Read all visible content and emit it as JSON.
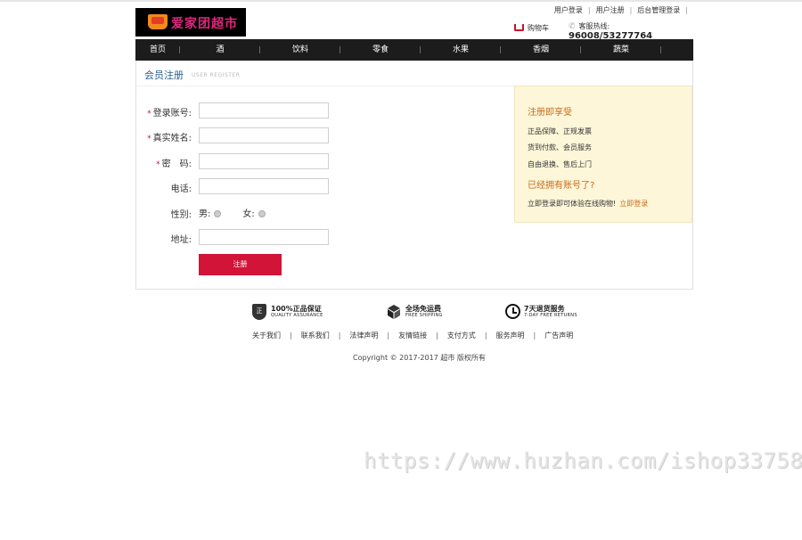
{
  "header": {
    "logo_text": "爱家团超市",
    "top_links": [
      "用户登录",
      "用户注册",
      "后台管理登录"
    ],
    "cart_label": "购物车",
    "hotline_label": "客服热线:",
    "hotline_number": "96008/53277764"
  },
  "nav": [
    "首页",
    "酒",
    "饮料",
    "零食",
    "水果",
    "香烟",
    "蔬菜"
  ],
  "panel": {
    "title": "会员注册",
    "subtitle": "USER REGISTER"
  },
  "form": {
    "account_label": "登录账号:",
    "realname_label": "真实姓名:",
    "password_label": "密　码:",
    "phone_label": "电话:",
    "gender_label": "性别:",
    "male_label": "男:",
    "female_label": "女:",
    "address_label": "地址:",
    "required_mark": "*",
    "submit_label": "注册"
  },
  "side": {
    "heading": "注册即享受",
    "benefits": [
      "正品保障、正规发票",
      "货到付款、会员服务",
      "自由退换、售后上门"
    ],
    "heading2": "已经拥有账号了?",
    "note": "立即登录即可体验在线购物!",
    "login_link": "立即登录"
  },
  "services": [
    {
      "icon": "shield-icon",
      "glyph": "正",
      "title": "100%正品保证",
      "sub": "QUALITY ASSURANCE"
    },
    {
      "icon": "box-icon",
      "title": "全场免运费",
      "sub": "FREE SHIPPING"
    },
    {
      "icon": "clock-icon",
      "title": "7天退货服务",
      "sub": "7-DAY FREE RETURNS"
    }
  ],
  "footer": {
    "links": [
      "关于我们",
      "联系我们",
      "法律声明",
      "友情链接",
      "支付方式",
      "服务声明",
      "广告声明"
    ],
    "copyright": "Copyright © 2017-2017 超市 版权所有"
  },
  "watermark": "https://www.huzhan.com/ishop33758"
}
